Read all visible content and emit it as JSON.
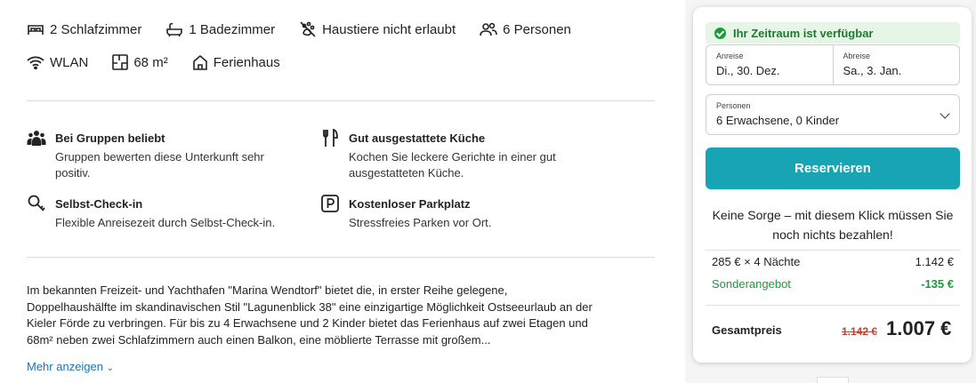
{
  "amenities": {
    "row1": [
      {
        "icon": "bed-icon",
        "label": "2 Schlafzimmer"
      },
      {
        "icon": "bathtub-icon",
        "label": "1 Badezimmer"
      },
      {
        "icon": "no-pets-icon",
        "label": "Haustiere nicht erlaubt"
      },
      {
        "icon": "people-icon",
        "label": "6 Personen"
      }
    ],
    "row2": [
      {
        "icon": "wifi-icon",
        "label": "WLAN"
      },
      {
        "icon": "floorplan-icon",
        "label": "68 m²"
      },
      {
        "icon": "house-icon",
        "label": "Ferienhaus"
      }
    ]
  },
  "features": [
    {
      "icon": "group-icon",
      "title": "Bei Gruppen beliebt",
      "text": "Gruppen bewerten diese Unterkunft sehr positiv."
    },
    {
      "icon": "cutlery-icon",
      "title": "Gut ausgestattete Küche",
      "text": "Kochen Sie leckere Gerichte in einer gut ausgestatteten Küche."
    },
    {
      "icon": "key-search-icon",
      "title": "Selbst-Check-in",
      "text": "Flexible Anreisezeit durch Selbst-Check-in."
    },
    {
      "icon": "parking-icon",
      "title": "Kostenloser Parkplatz",
      "text": "Stressfreies Parken vor Ort."
    }
  ],
  "description": "Im bekannten Freizeit- und Yachthafen \"Marina Wendtorf\" bietet die, in erster Reihe gelegene, Doppelhaushälfte im skandinavischen Stil \"Lagunenblick 38\" eine einzigartige Möglichkeit Ostseeurlaub an der Kieler Förde zu verbringen. Für bis zu 4 Erwachsene und 2 Kinder bietet das Ferienhaus auf zwei Etagen und 68m² neben zwei Schlafzimmern auch einen Balkon, eine möblierte Terrasse mit großem...",
  "more_label": "Mehr anzeigen",
  "booking": {
    "availability": "Ihr Zeitraum ist verfügbar",
    "checkin_label": "Anreise",
    "checkin_value": "Di., 30. Dez.",
    "checkout_label": "Abreise",
    "checkout_value": "Sa., 3. Jan.",
    "persons_label": "Personen",
    "persons_value": "6 Erwachsene, 0 Kinder",
    "reserve_label": "Reservieren",
    "no_cost_note": "Keine Sorge – mit diesem Klick müssen Sie noch nichts bezahlen!",
    "nights_label": "285 € × 4 Nächte",
    "nights_value": "1.142 €",
    "special_label": "Sonderangebot",
    "special_value": "-135 €",
    "total_label": "Gesamtpreis",
    "old_total": "1.142 €",
    "new_total": "1.007 €"
  },
  "colors": {
    "accent": "#17a5b5",
    "success": "#1c9b39",
    "strike": "#d9391f",
    "link": "#1a73b8"
  }
}
